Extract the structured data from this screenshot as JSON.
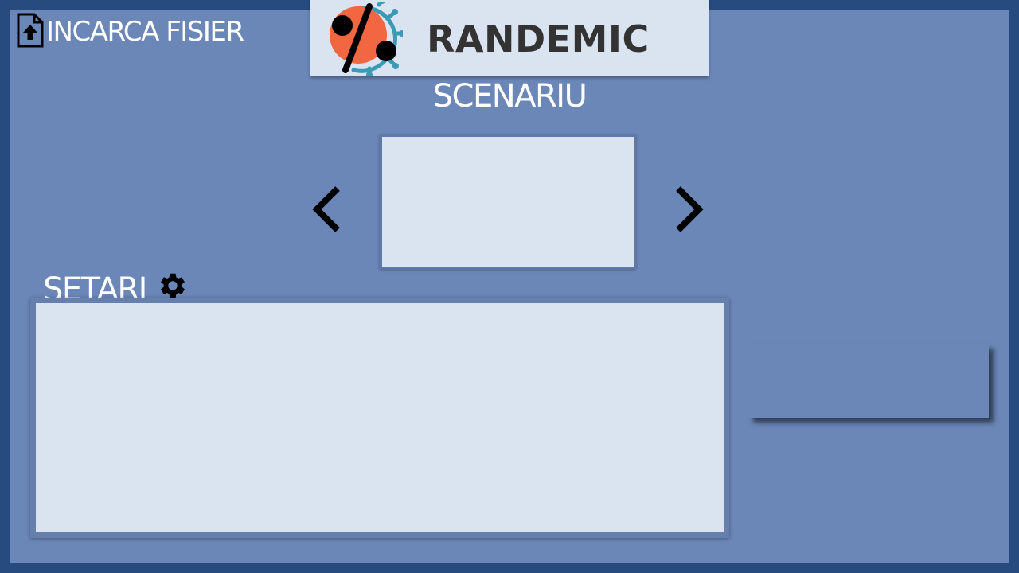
{
  "upload": {
    "label": "INCARCA FISIER",
    "icon": "file-upload-icon"
  },
  "header": {
    "brand": "RANDEMIC",
    "logo": "virus-percent-logo"
  },
  "scenario": {
    "title": "SCENARIU",
    "prev_icon": "chevron-left-icon",
    "next_icon": "chevron-right-icon"
  },
  "settings": {
    "title": "SETARI",
    "icon": "gear-icon"
  },
  "colors": {
    "border": "#274b7f",
    "background": "#6b87b8",
    "panel": "#dae4f0",
    "brand_text": "#333333",
    "logo_red": "#f26641",
    "logo_teal": "#3b9bb5"
  }
}
